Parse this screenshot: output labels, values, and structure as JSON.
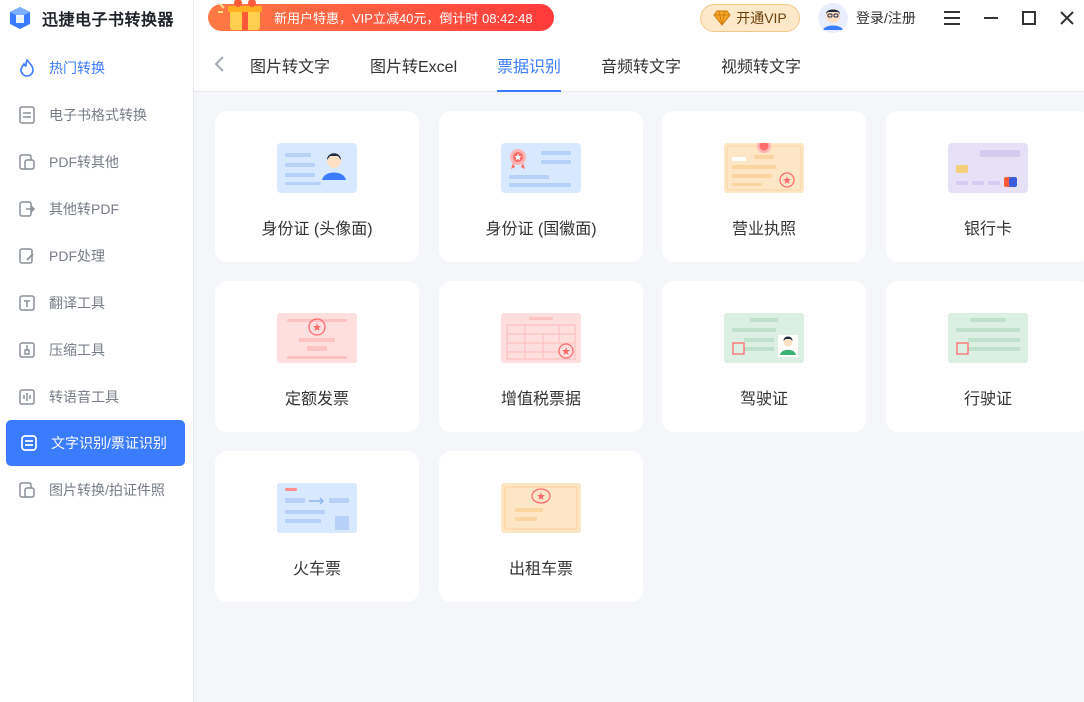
{
  "app": {
    "title": "迅捷电子书转换器"
  },
  "sidebar": {
    "items": [
      {
        "label": "热门转换",
        "icon": "flame-icon"
      },
      {
        "label": "电子书格式转换",
        "icon": "ebook-convert-icon"
      },
      {
        "label": "PDF转其他",
        "icon": "pdf-out-icon"
      },
      {
        "label": "其他转PDF",
        "icon": "pdf-in-icon"
      },
      {
        "label": "PDF处理",
        "icon": "pdf-process-icon"
      },
      {
        "label": "翻译工具",
        "icon": "translate-icon"
      },
      {
        "label": "压缩工具",
        "icon": "compress-icon"
      },
      {
        "label": "转语音工具",
        "icon": "audio-icon"
      },
      {
        "label": "文字识别/票证识别",
        "icon": "ocr-icon"
      },
      {
        "label": "图片转换/拍证件照",
        "icon": "image-convert-icon"
      }
    ]
  },
  "header": {
    "promo_text": "新用户特惠，VIP立减40元，倒计时 08:42:48",
    "vip_label": "开通VIP",
    "login_label": "登录/注册"
  },
  "tabs": [
    {
      "label": "图片转文字"
    },
    {
      "label": "图片转Excel"
    },
    {
      "label": "票据识别"
    },
    {
      "label": "音频转文字"
    },
    {
      "label": "视频转文字"
    }
  ],
  "cards": [
    {
      "label": "身份证 (头像面)",
      "icon": "id-card-front-icon"
    },
    {
      "label": "身份证 (国徽面)",
      "icon": "id-card-back-icon"
    },
    {
      "label": "营业执照",
      "icon": "business-license-icon"
    },
    {
      "label": "银行卡",
      "icon": "bank-card-icon"
    },
    {
      "label": "定额发票",
      "icon": "fixed-invoice-icon"
    },
    {
      "label": "增值税票据",
      "icon": "vat-invoice-icon"
    },
    {
      "label": "驾驶证",
      "icon": "driver-license-icon"
    },
    {
      "label": "行驶证",
      "icon": "vehicle-license-icon"
    },
    {
      "label": "火车票",
      "icon": "train-ticket-icon"
    },
    {
      "label": "出租车票",
      "icon": "taxi-receipt-icon"
    }
  ],
  "colors": {
    "accent": "#3b7cff",
    "promo_start": "#ff7a45",
    "promo_end": "#ff3b3b",
    "vip_bg": "#fde8c9"
  }
}
